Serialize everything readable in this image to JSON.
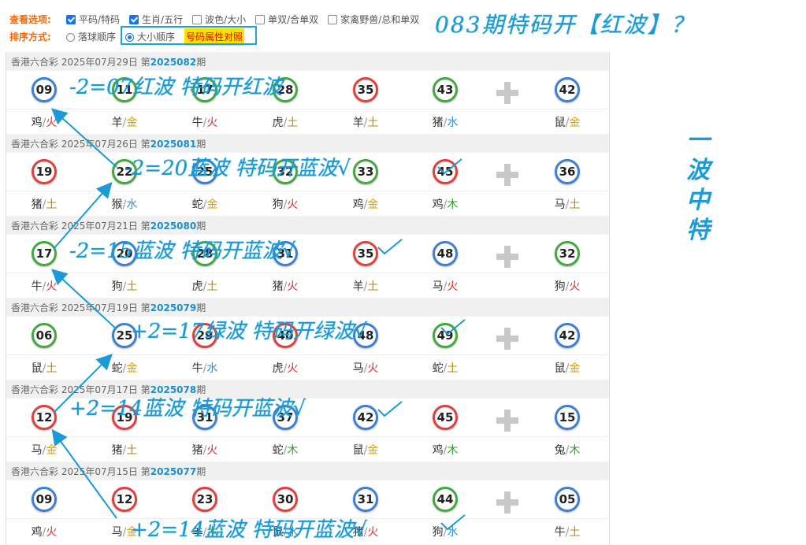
{
  "options": {
    "row1_title": "查看选项:",
    "row1": [
      {
        "label": "平码/特码",
        "checked": true
      },
      {
        "label": "生肖/五行",
        "checked": true
      },
      {
        "label": "波色/大小",
        "checked": false
      },
      {
        "label": "单双/合单双",
        "checked": false
      },
      {
        "label": "家禽野兽/总和单双",
        "checked": false
      }
    ],
    "row2_title": "排序方式:",
    "row2": [
      {
        "label": "落球顺序",
        "selected": false
      },
      {
        "label": "大小顺序",
        "selected": true
      }
    ],
    "highlight_label": "号码属性对照"
  },
  "annotation_title": "083期特码开【红波】？",
  "vertical_note": [
    "一",
    "波",
    "中",
    "特"
  ],
  "draws": [
    {
      "lottery": "香港六合彩",
      "date": "2025年07月29日",
      "prefix": "第",
      "period": "2025082",
      "suffix": "期",
      "balls": [
        {
          "n": "09",
          "c": "blue"
        },
        {
          "n": "11",
          "c": "green"
        },
        {
          "n": "17",
          "c": "green"
        },
        {
          "n": "28",
          "c": "green"
        },
        {
          "n": "35",
          "c": "red"
        },
        {
          "n": "43",
          "c": "green"
        },
        {
          "n": "42",
          "c": "blue"
        }
      ],
      "zodiacs": [
        {
          "z": "鸡",
          "e": "火",
          "k": "huo"
        },
        {
          "z": "羊",
          "e": "金",
          "k": "jin"
        },
        {
          "z": "牛",
          "e": "火",
          "k": "huo"
        },
        {
          "z": "虎",
          "e": "土",
          "k": "tu"
        },
        {
          "z": "羊",
          "e": "土",
          "k": "tu"
        },
        {
          "z": "猪",
          "e": "水",
          "k": "shui"
        },
        {
          "z": "鼠",
          "e": "金",
          "k": "jin"
        }
      ],
      "note": "-2=07红波 特码开红波"
    },
    {
      "lottery": "香港六合彩",
      "date": "2025年07月26日",
      "prefix": "第",
      "period": "2025081",
      "suffix": "期",
      "balls": [
        {
          "n": "19",
          "c": "red"
        },
        {
          "n": "22",
          "c": "green"
        },
        {
          "n": "25",
          "c": "blue"
        },
        {
          "n": "32",
          "c": "green"
        },
        {
          "n": "33",
          "c": "green"
        },
        {
          "n": "45",
          "c": "red"
        },
        {
          "n": "36",
          "c": "blue"
        }
      ],
      "zodiacs": [
        {
          "z": "猪",
          "e": "土",
          "k": "tu"
        },
        {
          "z": "猴",
          "e": "水",
          "k": "shui"
        },
        {
          "z": "蛇",
          "e": "金",
          "k": "jin"
        },
        {
          "z": "狗",
          "e": "火",
          "k": "huo"
        },
        {
          "z": "鸡",
          "e": "金",
          "k": "jin"
        },
        {
          "z": "鸡",
          "e": "木",
          "k": "mu"
        },
        {
          "z": "马",
          "e": "土",
          "k": "tu"
        }
      ],
      "note": "-2=20蓝波 特码开蓝波√"
    },
    {
      "lottery": "香港六合彩",
      "date": "2025年07月21日",
      "prefix": "第",
      "period": "2025080",
      "suffix": "期",
      "balls": [
        {
          "n": "17",
          "c": "green"
        },
        {
          "n": "20",
          "c": "blue"
        },
        {
          "n": "28",
          "c": "green"
        },
        {
          "n": "31",
          "c": "blue"
        },
        {
          "n": "35",
          "c": "red"
        },
        {
          "n": "48",
          "c": "blue"
        },
        {
          "n": "32",
          "c": "green"
        }
      ],
      "zodiacs": [
        {
          "z": "牛",
          "e": "火",
          "k": "huo"
        },
        {
          "z": "狗",
          "e": "土",
          "k": "tu"
        },
        {
          "z": "虎",
          "e": "土",
          "k": "tu"
        },
        {
          "z": "猪",
          "e": "火",
          "k": "huo"
        },
        {
          "z": "羊",
          "e": "土",
          "k": "tu"
        },
        {
          "z": "马",
          "e": "火",
          "k": "huo"
        },
        {
          "z": "狗",
          "e": "火",
          "k": "huo"
        }
      ],
      "note": "-2=15蓝波 特码开蓝波√"
    },
    {
      "lottery": "香港六合彩",
      "date": "2025年07月19日",
      "prefix": "第",
      "period": "2025079",
      "suffix": "期",
      "balls": [
        {
          "n": "06",
          "c": "green"
        },
        {
          "n": "25",
          "c": "blue"
        },
        {
          "n": "29",
          "c": "red"
        },
        {
          "n": "40",
          "c": "red"
        },
        {
          "n": "48",
          "c": "blue"
        },
        {
          "n": "49",
          "c": "green"
        },
        {
          "n": "42",
          "c": "blue"
        }
      ],
      "zodiacs": [
        {
          "z": "鼠",
          "e": "土",
          "k": "tu"
        },
        {
          "z": "蛇",
          "e": "金",
          "k": "jin"
        },
        {
          "z": "牛",
          "e": "水",
          "k": "shui"
        },
        {
          "z": "虎",
          "e": "火",
          "k": "huo"
        },
        {
          "z": "马",
          "e": "火",
          "k": "huo"
        },
        {
          "z": "蛇",
          "e": "土",
          "k": "tu"
        },
        {
          "z": "鼠",
          "e": "金",
          "k": "jin"
        }
      ],
      "note": "+2=17绿波 特码开绿波√"
    },
    {
      "lottery": "香港六合彩",
      "date": "2025年07月17日",
      "prefix": "第",
      "period": "2025078",
      "suffix": "期",
      "balls": [
        {
          "n": "12",
          "c": "red"
        },
        {
          "n": "19",
          "c": "red"
        },
        {
          "n": "31",
          "c": "blue"
        },
        {
          "n": "37",
          "c": "blue"
        },
        {
          "n": "42",
          "c": "blue"
        },
        {
          "n": "45",
          "c": "red"
        },
        {
          "n": "15",
          "c": "blue"
        }
      ],
      "zodiacs": [
        {
          "z": "马",
          "e": "金",
          "k": "jin"
        },
        {
          "z": "猪",
          "e": "土",
          "k": "tu"
        },
        {
          "z": "猪",
          "e": "火",
          "k": "huo"
        },
        {
          "z": "蛇",
          "e": "木",
          "k": "mu"
        },
        {
          "z": "鼠",
          "e": "金",
          "k": "jin"
        },
        {
          "z": "鸡",
          "e": "木",
          "k": "mu"
        },
        {
          "z": "兔",
          "e": "木",
          "k": "mu"
        }
      ],
      "note": "+2=14蓝波 特码开蓝波√"
    },
    {
      "lottery": "香港六合彩",
      "date": "2025年07月15日",
      "prefix": "第",
      "period": "2025077",
      "suffix": "期",
      "balls": [
        {
          "n": "09",
          "c": "blue"
        },
        {
          "n": "12",
          "c": "red"
        },
        {
          "n": "23",
          "c": "red"
        },
        {
          "n": "30",
          "c": "red"
        },
        {
          "n": "31",
          "c": "blue"
        },
        {
          "n": "44",
          "c": "green"
        },
        {
          "n": "05",
          "c": "blue"
        }
      ],
      "zodiacs": [
        {
          "z": "鸡",
          "e": "火",
          "k": "huo"
        },
        {
          "z": "马",
          "e": "金",
          "k": "jin"
        },
        {
          "z": "羊",
          "e": "木",
          "k": "mu"
        },
        {
          "z": "鼠",
          "e": "水",
          "k": "shui"
        },
        {
          "z": "猪",
          "e": "火",
          "k": "huo"
        },
        {
          "z": "狗",
          "e": "水",
          "k": "shui"
        },
        {
          "z": "牛",
          "e": "土",
          "k": "tu"
        }
      ],
      "note": "+2=14蓝波 特码开蓝波√"
    }
  ]
}
